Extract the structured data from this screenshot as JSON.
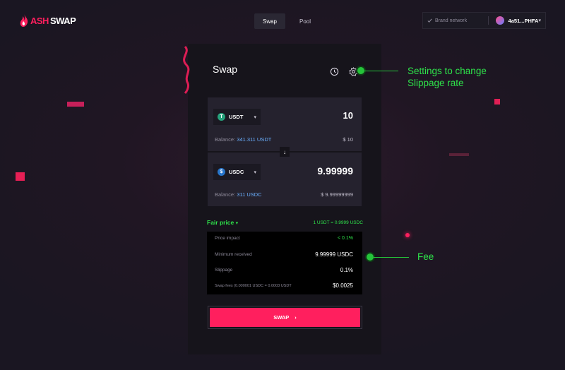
{
  "header": {
    "logo": {
      "ash": "ASH",
      "swap": "SWAP"
    },
    "nav_tabs": [
      {
        "label": "Swap",
        "active": true
      },
      {
        "label": "Pool",
        "active": false
      }
    ],
    "network_label": "Brand network",
    "wallet_address": "4a51...PHFA"
  },
  "swap_panel": {
    "title": "Swap",
    "from": {
      "token": "USDT",
      "amount": "10",
      "balance_label": "Balance:",
      "balance_value": "341.311 USDT",
      "usd_value": "$ 10"
    },
    "to": {
      "token": "USDC",
      "amount": "9.99999",
      "balance_label": "Balance:",
      "balance_value": "311 USDC",
      "usd_value": "$ 9.99999999"
    },
    "fair_price_label": "Fair price",
    "rate": "1 USDT = 0.9999 USDC",
    "details": [
      {
        "label": "Price impact",
        "value": "< 0.1%"
      },
      {
        "label": "Minimum received",
        "value": "9.99999 USDC"
      },
      {
        "label": "Slippage",
        "value": "0.1%"
      },
      {
        "label": "Swap fees (0.000001 USDC = 0.0003 USDT",
        "value": "$0.0025"
      }
    ],
    "swap_button": "SWAP"
  },
  "callouts": {
    "settings": [
      "Settings to change",
      "Slippage rate"
    ],
    "fee": "Fee"
  },
  "colors": {
    "accent": "#ff1f5e",
    "callout": "#2ee24a",
    "panel": "#16141b",
    "background": "#1a1622"
  }
}
